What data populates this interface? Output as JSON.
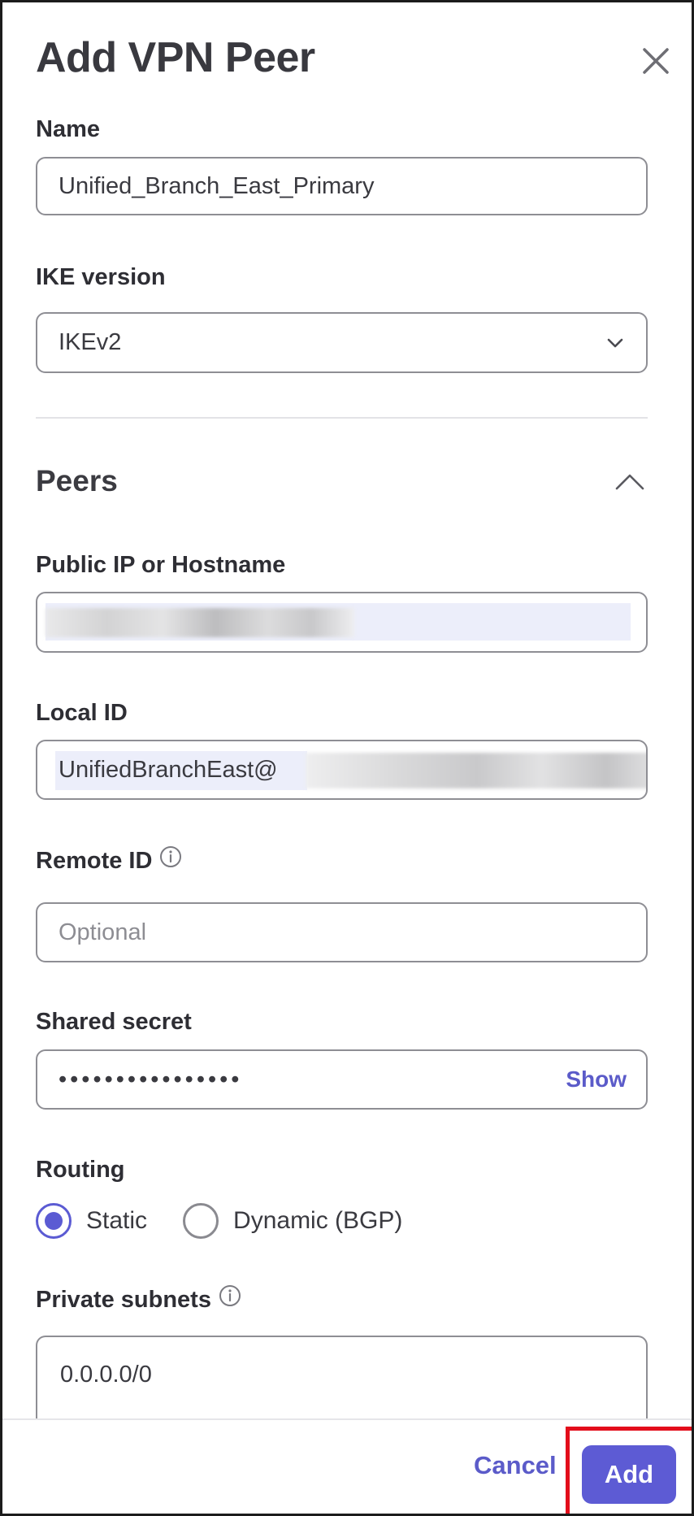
{
  "dialog": {
    "title": "Add VPN Peer"
  },
  "form": {
    "name": {
      "label": "Name",
      "value": "Unified_Branch_East_Primary"
    },
    "ike_version": {
      "label": "IKE version",
      "value": "IKEv2"
    },
    "peers_section": {
      "title": "Peers"
    },
    "public_ip": {
      "label": "Public IP or Hostname",
      "value": ""
    },
    "local_id": {
      "label": "Local ID",
      "value": "UnifiedBranchEast@"
    },
    "remote_id": {
      "label": "Remote ID",
      "placeholder": "Optional"
    },
    "shared_secret": {
      "label": "Shared secret",
      "value": "••••••••••••••••",
      "toggle_label": "Show"
    },
    "routing": {
      "label": "Routing",
      "options": [
        {
          "label": "Static",
          "selected": true
        },
        {
          "label": "Dynamic (BGP)",
          "selected": false
        }
      ]
    },
    "private_subnets": {
      "label": "Private subnets",
      "value": "0.0.0.0/0"
    }
  },
  "footer": {
    "cancel_label": "Cancel",
    "add_label": "Add"
  },
  "colors": {
    "accent": "#5d5bd4",
    "highlight": "#e30d1b",
    "text": "#2e2e34",
    "border": "#8e8e94"
  },
  "icons": {
    "close": "close-icon",
    "select": "chevron-down-icon",
    "collapse": "chevron-up-icon",
    "info": "info-icon"
  }
}
